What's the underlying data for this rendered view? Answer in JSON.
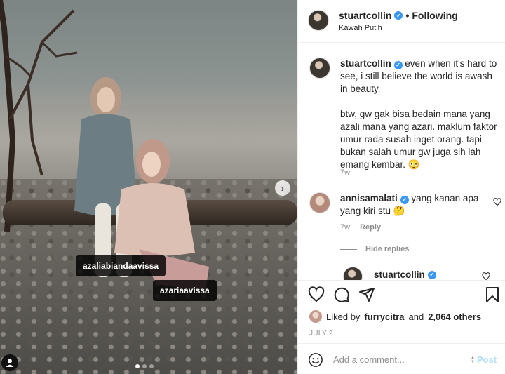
{
  "photo": {
    "tags": [
      "azaliabiandaavissa",
      "azariaavissa"
    ],
    "next_icon": "chevron-right-icon",
    "user_tag_icon": "person-icon",
    "carousel_position": 1,
    "carousel_count": 3
  },
  "header": {
    "username": "stuartcollin",
    "separator": "•",
    "follow_status": "Following",
    "location": "Kawah Putih"
  },
  "caption": {
    "username": "stuartcollin",
    "text_1": "even when it's hard to see, i still believe the world is awash in beauty.",
    "text_2": "btw, gw gak bisa bedain mana yang azali mana yang azari. maklum faktor umur rada susah inget orang. tapi bukan salah umur gw juga sih lah emang kembar. 😳",
    "time": "7w"
  },
  "comment": {
    "username": "annisamalati",
    "text": "yang kanan apa yang kiri stu 🤔",
    "time": "7w",
    "reply_label": "Reply",
    "hide_replies_label": "Hide replies"
  },
  "reply": {
    "username": "stuartcollin"
  },
  "actions": {
    "icons": [
      "heart-icon",
      "comment-icon",
      "share-icon",
      "bookmark-icon"
    ],
    "liked_by_prefix": "Liked by",
    "liked_by_user": "furrycitra",
    "liked_by_and": "and",
    "liked_by_count": "2,064 others",
    "date": "JULY 2"
  },
  "add_comment": {
    "placeholder": "Add a comment...",
    "post_label": "Post",
    "emoji_icon": "smiley-icon"
  },
  "colors": {
    "verified": "#3897f0",
    "post_disabled": "#b2dffc",
    "meta_text": "#8e8e8e"
  }
}
